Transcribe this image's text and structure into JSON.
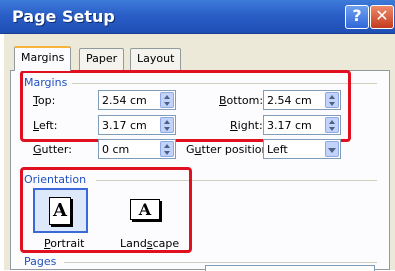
{
  "window": {
    "title": "Page Setup",
    "help_glyph": "?",
    "close_glyph": "✕"
  },
  "tabs": [
    {
      "label": "Margins"
    },
    {
      "label": "Paper"
    },
    {
      "label": "Layout"
    }
  ],
  "margins": {
    "group_label": "Margins",
    "top": {
      "label": "Top:",
      "value": "2.54 cm"
    },
    "bottom": {
      "label": "Bottom:",
      "value": "2.54 cm"
    },
    "left": {
      "label": "Left:",
      "value": "3.17 cm"
    },
    "right": {
      "label": "Right:",
      "value": "3.17 cm"
    },
    "gutter": {
      "label": "Gutter:",
      "value": "0 cm"
    },
    "gutter_position": {
      "label": "Gutter position:",
      "value": "Left"
    }
  },
  "orientation": {
    "group_label": "Orientation",
    "portrait": {
      "label": "Portrait",
      "glyph": "A",
      "selected": true
    },
    "landscape": {
      "label": "Landscape",
      "glyph": "A",
      "selected": false
    }
  },
  "pages": {
    "group_label": "Pages"
  },
  "colors": {
    "highlight_box": "#e01020",
    "group_label": "#2050c0",
    "title_bar": "#2a5fc8"
  }
}
